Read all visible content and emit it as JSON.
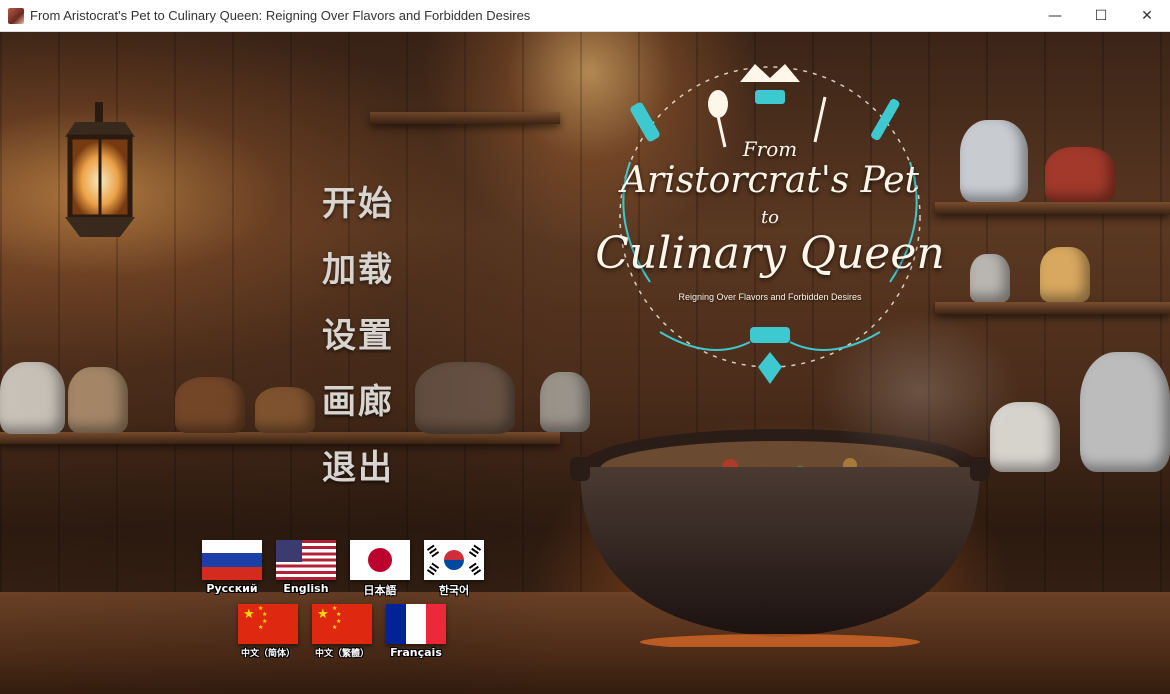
{
  "window": {
    "title": "From Aristocrat's Pet to Culinary Queen: Reigning Over Flavors and Forbidden Desires",
    "controls": {
      "minimize": "—",
      "maximize": "☐",
      "close": "✕"
    }
  },
  "logo": {
    "from": "From",
    "line1": "Aristorcrat's Pet",
    "to": "to",
    "line2": "Culinary Queen",
    "subtitle": "Reigning Over Flavors and Forbidden Desires"
  },
  "menu": {
    "start": "开始",
    "load": "加载",
    "settings": "设置",
    "gallery": "画廊",
    "quit": "退出"
  },
  "languages": {
    "russian": "Русский",
    "english": "English",
    "japanese": "日本語",
    "korean": "한국어",
    "chinese_simplified": "中文（简体）",
    "chinese_traditional": "中文（繁體）",
    "french": "Français"
  },
  "colors": {
    "menu_text": "#d8d4d0",
    "logo_text": "#fff6ea",
    "logo_accent": "#3ec9d0"
  }
}
